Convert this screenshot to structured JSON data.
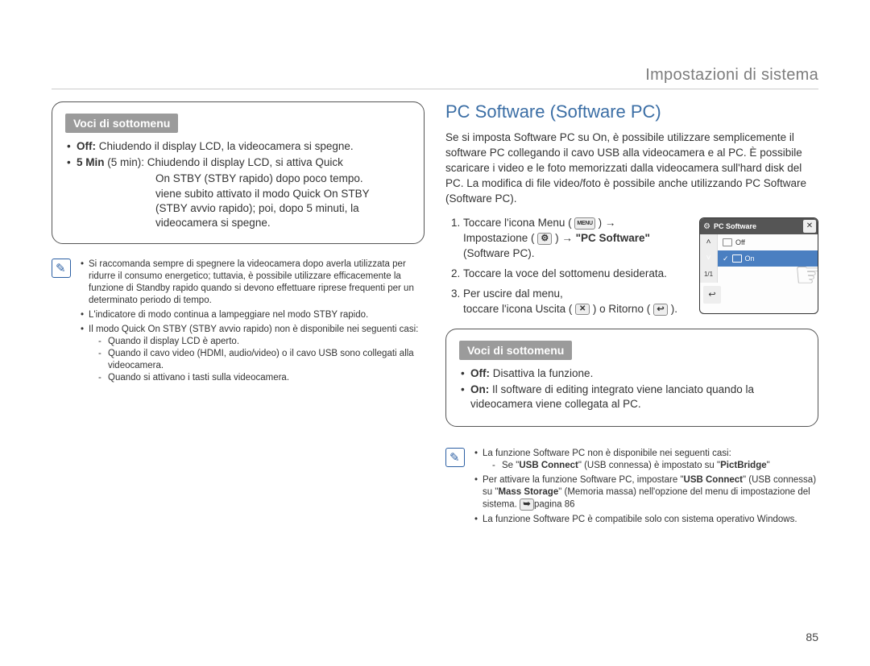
{
  "header": {
    "section": "Impostazioni di sistema"
  },
  "left": {
    "submenu_title": "Voci di sottomenu",
    "item_off": {
      "bold": "Off:",
      "text": " Chiudendo il display LCD, la videocamera si spegne."
    },
    "item_5min": {
      "bold": "5 Min",
      "paren": " (5 min):  ",
      "l1": "Chiudendo il display LCD, si attiva Quick",
      "l2": "On STBY (STBY rapido) dopo poco tempo.",
      "l3": "viene subito attivato il modo Quick On STBY",
      "l4": "(STBY avvio rapido); poi, dopo 5 minuti, la",
      "l5": "videocamera si spegne."
    },
    "notes": {
      "n1": "Si raccomanda sempre di spegnere la videocamera dopo averla utilizzata per ridurre il consumo energetico; tuttavia, è possibile utilizzare efficacemente la funzione di Standby rapido quando si devono effettuare riprese frequenti per un determinato periodo di tempo.",
      "n2": "L'indicatore di modo continua a lampeggiare nel modo STBY rapido.",
      "n3": "Il modo Quick On STBY (STBY avvio rapido) non è disponibile nei seguenti casi:",
      "d1": "Quando il display LCD è aperto.",
      "d2": "Quando il cavo video (HDMI, audio/video) o il cavo USB sono collegati alla videocamera.",
      "d3": "Quando si attivano i tasti sulla videocamera."
    }
  },
  "right": {
    "title": "PC Software (Software PC)",
    "intro": "Se si imposta Software PC su On, è possibile utilizzare semplicemente il software PC collegando il cavo USB alla videocamera e al PC. È possibile scaricare i video e le foto memorizzati dalla videocamera sull'hard disk del PC. La modifica di file video/foto è possibile anche utilizzando PC Software (Software PC).",
    "steps": {
      "s1a": "Toccare l'icona Menu (",
      "s1b": ") ",
      "s1c": "Impostazione (",
      "s1d": ") ",
      "s1e_bold": "\"PC Software\"",
      "s1e_rest": " (Software PC).",
      "s2": "Toccare la voce del sottomenu desiderata.",
      "s3a": "Per uscire dal menu,",
      "s3b": "toccare l'icona Uscita (",
      "s3c": ") o Ritorno (",
      "s3d": ")."
    },
    "submenu_title": "Voci di sottomenu",
    "sub_off": {
      "bold": "Off:",
      "text": " Disattiva la funzione."
    },
    "sub_on": {
      "bold": "On:",
      "text": " Il software di editing integrato viene lanciato quando la videocamera viene collegata al PC."
    },
    "notes": {
      "n1": "La funzione Software PC non è disponibile nei seguenti casi:",
      "d1a": "Se \"",
      "d1b": "USB Connect",
      "d1c": "\" (USB connessa) è impostato su \"",
      "d1d": "PictBridge",
      "d1e": "\"",
      "n2a": "Per attivare la funzione Software PC, impostare \"",
      "n2b": "USB Connect",
      "n2c": "\" (USB connessa) su \"",
      "n2d": "Mass Storage",
      "n2e": "\" (Memoria massa) nell'opzione del menu di impostazione del sistema. ",
      "n2f": "pagina 86",
      "n3": "La funzione Software PC è compatibile solo con sistema operativo Windows."
    },
    "screen": {
      "title": "PC Software",
      "opt_off": "Off",
      "opt_on": "On",
      "page": "1/1"
    }
  },
  "pagenum": "85"
}
